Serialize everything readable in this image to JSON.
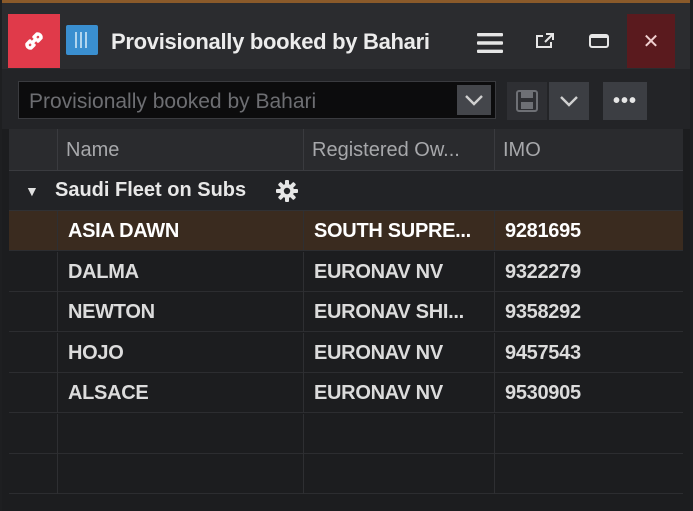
{
  "window": {
    "title": "Provisionally booked by Bahari",
    "close_glyph": "✕"
  },
  "filter": {
    "value": "Provisionally booked by Bahari",
    "more_label": "•••"
  },
  "grid": {
    "columns": [
      "Name",
      "Registered Ow...",
      "IMO"
    ],
    "group": {
      "label": "Saudi Fleet on Subs",
      "chevron": "▼"
    },
    "rows": [
      {
        "name": "ASIA DAWN",
        "owner": "SOUTH SUPRE...",
        "imo": "9281695",
        "selected": true
      },
      {
        "name": "DALMA",
        "owner": "EURONAV NV",
        "imo": "9322279"
      },
      {
        "name": "NEWTON",
        "owner": "EURONAV SHI...",
        "imo": "9358292"
      },
      {
        "name": "HOJO",
        "owner": "EURONAV NV",
        "imo": "9457543"
      },
      {
        "name": "ALSACE",
        "owner": "EURONAV NV",
        "imo": "9530905"
      }
    ]
  },
  "colors": {
    "accent_red": "#e03a4a",
    "selected_row": "#3a2b1f",
    "app_icon": "#3a8fd0",
    "close_bg": "#5a1a1e"
  },
  "icons": {
    "link": "link-icon",
    "app": "grid-app-icon",
    "menu": "hamburger-icon",
    "popout": "popout-icon",
    "maximize": "maximize-icon",
    "close": "close-icon",
    "dropdown": "chevron-down-icon",
    "save": "save-icon",
    "settings": "gear-icon"
  }
}
